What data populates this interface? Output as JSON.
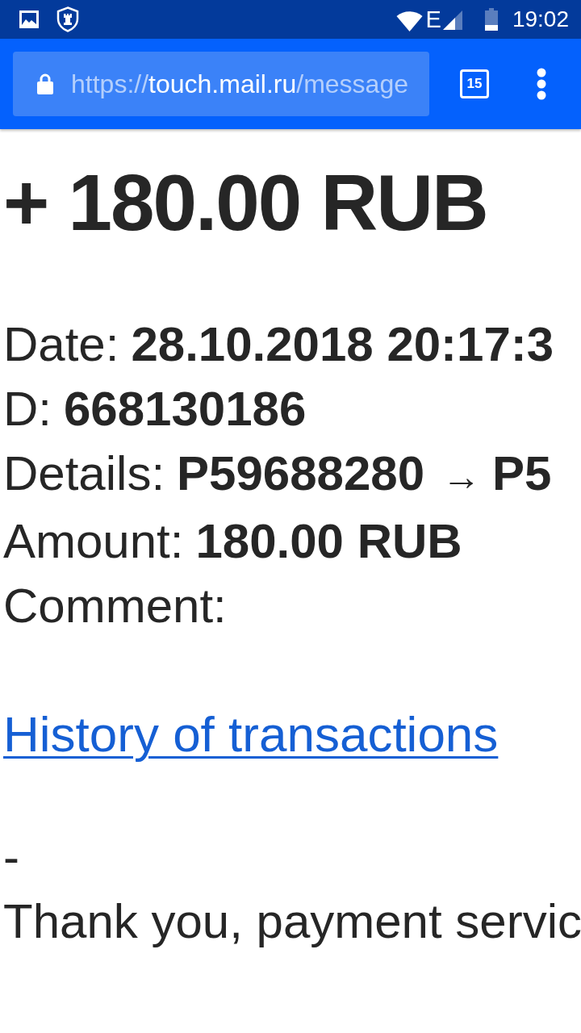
{
  "status_bar": {
    "network_type": "E",
    "time": "19:02"
  },
  "browser": {
    "url_parts": [
      {
        "kind": "dim",
        "text": "https://"
      },
      {
        "kind": "host",
        "text": "touch.mail.ru"
      },
      {
        "kind": "dim",
        "text": "/message"
      }
    ],
    "tab_count": "15"
  },
  "email": {
    "heading": "+ 180.00 RUB",
    "fields": [
      {
        "kind": "plain",
        "label": "Date:",
        "value": "28.10.2018 20:17:3"
      },
      {
        "kind": "plain",
        "label": "D:",
        "value": "668130186"
      },
      {
        "kind": "transfer",
        "label": "Details:",
        "from": "P59688280",
        "arrow": "→",
        "to": "P5"
      },
      {
        "kind": "plain",
        "label": "Amount:",
        "value": "180.00 RUB"
      },
      {
        "kind": "plain",
        "label": "Comment:"
      }
    ],
    "link": "History of transactions",
    "separator": "-",
    "closing": "Thank you, payment servic"
  }
}
